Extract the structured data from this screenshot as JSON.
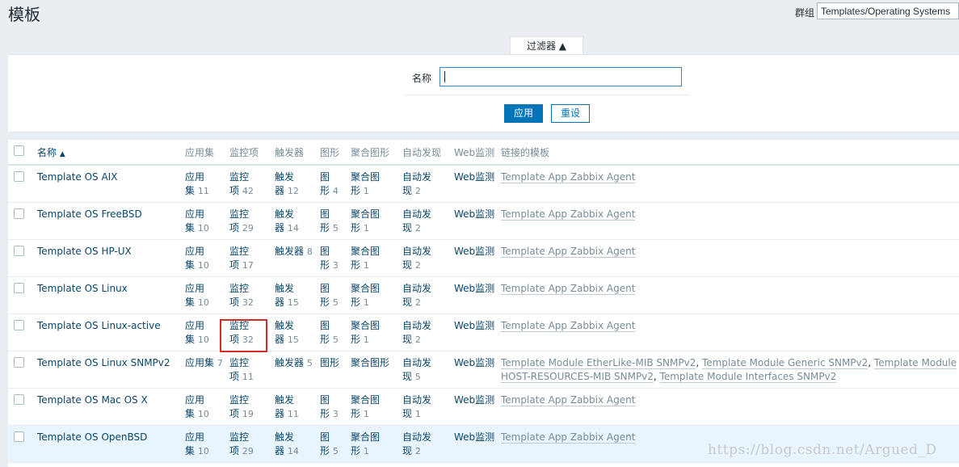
{
  "page": {
    "title": "模板"
  },
  "group": {
    "label": "群组",
    "value": "Templates/Operating Systems"
  },
  "filter": {
    "tab_label": "过滤器 ▲",
    "name_label": "名称",
    "name_value": "",
    "apply_label": "应用",
    "reset_label": "重设"
  },
  "table": {
    "headers": {
      "name": "名称",
      "name_sort": "▲",
      "apps": "应用集",
      "items": "监控项",
      "triggers": "触发器",
      "graphs": "图形",
      "screens": "聚合图形",
      "discovery": "自动发现",
      "web": "Web监测",
      "linked": "链接的模板"
    },
    "rows": [
      {
        "name": "Template OS AIX",
        "apps": [
          "应用",
          "集"
        ],
        "apps_count": "11",
        "items": [
          "监控",
          "项"
        ],
        "items_count": "42",
        "triggers": [
          "触发",
          "器"
        ],
        "triggers_count": "12",
        "graphs": [
          "图",
          "形"
        ],
        "graphs_count": "4",
        "screens": [
          "聚合图",
          "形"
        ],
        "screens_count": "1",
        "discovery": [
          "自动发",
          "现"
        ],
        "discovery_count": "2",
        "web": "Web监测",
        "linked": [
          "Template App Zabbix Agent"
        ]
      },
      {
        "name": "Template OS FreeBSD",
        "apps": [
          "应用",
          "集"
        ],
        "apps_count": "10",
        "items": [
          "监控",
          "项"
        ],
        "items_count": "29",
        "triggers": [
          "触发",
          "器"
        ],
        "triggers_count": "14",
        "graphs": [
          "图",
          "形"
        ],
        "graphs_count": "5",
        "screens": [
          "聚合图",
          "形"
        ],
        "screens_count": "1",
        "discovery": [
          "自动发",
          "现"
        ],
        "discovery_count": "2",
        "web": "Web监测",
        "linked": [
          "Template App Zabbix Agent"
        ]
      },
      {
        "name": "Template OS HP-UX",
        "apps": [
          "应用",
          "集"
        ],
        "apps_count": "10",
        "items": [
          "监控",
          "项"
        ],
        "items_count": "17",
        "triggers": [
          "触发器",
          ""
        ],
        "triggers_count": "8",
        "graphs": [
          "图",
          "形"
        ],
        "graphs_count": "3",
        "screens": [
          "聚合图",
          "形"
        ],
        "screens_count": "1",
        "discovery": [
          "自动发",
          "现"
        ],
        "discovery_count": "2",
        "web": "Web监测",
        "linked": [
          "Template App Zabbix Agent"
        ]
      },
      {
        "name": "Template OS Linux",
        "apps": [
          "应用",
          "集"
        ],
        "apps_count": "10",
        "items": [
          "监控",
          "项"
        ],
        "items_count": "32",
        "triggers": [
          "触发",
          "器"
        ],
        "triggers_count": "15",
        "graphs": [
          "图",
          "形"
        ],
        "graphs_count": "5",
        "screens": [
          "聚合图",
          "形"
        ],
        "screens_count": "1",
        "discovery": [
          "自动发",
          "现"
        ],
        "discovery_count": "2",
        "web": "Web监测",
        "linked": [
          "Template App Zabbix Agent"
        ]
      },
      {
        "name": "Template OS Linux-active",
        "apps": [
          "应用",
          "集"
        ],
        "apps_count": "10",
        "items": [
          "监控",
          "项"
        ],
        "items_count": "32",
        "triggers": [
          "触发",
          "器"
        ],
        "triggers_count": "15",
        "graphs": [
          "图",
          "形"
        ],
        "graphs_count": "5",
        "screens": [
          "聚合图",
          "形"
        ],
        "screens_count": "1",
        "discovery": [
          "自动发",
          "现"
        ],
        "discovery_count": "2",
        "web": "Web监测",
        "linked": [
          "Template App Zabbix Agent"
        ]
      },
      {
        "name": "Template OS Linux SNMPv2",
        "apps": [
          "应用集",
          ""
        ],
        "apps_count": "7",
        "items": [
          "监控",
          "项"
        ],
        "items_count": "11",
        "triggers": [
          "触发器",
          ""
        ],
        "triggers_count": "5",
        "graphs": [
          "图形",
          ""
        ],
        "graphs_count": "",
        "screens": [
          "聚合图形",
          ""
        ],
        "screens_count": "",
        "discovery": [
          "自动发",
          "现"
        ],
        "discovery_count": "5",
        "web": "Web监测",
        "linked": [
          "Template Module EtherLike-MIB SNMPv2",
          "Template Module Generic SNMPv2",
          "Template Module HOST-RESOURCES-MIB SNMPv2",
          "Template Module Interfaces SNMPv2"
        ]
      },
      {
        "name": "Template OS Mac OS X",
        "apps": [
          "应用",
          "集"
        ],
        "apps_count": "10",
        "items": [
          "监控",
          "项"
        ],
        "items_count": "19",
        "triggers": [
          "触发",
          "器"
        ],
        "triggers_count": "11",
        "graphs": [
          "图",
          "形"
        ],
        "graphs_count": "3",
        "screens": [
          "聚合图",
          "形"
        ],
        "screens_count": "1",
        "discovery": [
          "自动发",
          "现"
        ],
        "discovery_count": "1",
        "web": "Web监测",
        "linked": [
          "Template App Zabbix Agent"
        ]
      },
      {
        "name": "Template OS OpenBSD",
        "apps": [
          "应用",
          "集"
        ],
        "apps_count": "10",
        "items": [
          "监控",
          "项"
        ],
        "items_count": "29",
        "triggers": [
          "触发",
          "器"
        ],
        "triggers_count": "14",
        "graphs": [
          "图",
          "形"
        ],
        "graphs_count": "5",
        "screens": [
          "聚合图",
          "形"
        ],
        "screens_count": "1",
        "discovery": [
          "自动发",
          "现"
        ],
        "discovery_count": "2",
        "web": "Web监测",
        "linked": [
          "Template App Zabbix Agent"
        ]
      }
    ]
  },
  "watermark": "https://blog.csdn.net/Argued_D",
  "colors": {
    "accent": "#0275b8",
    "link": "#0a466a",
    "muted": "#768d99",
    "highlight_row": "#e8f5ff",
    "annotation_box": "#d42b2b"
  }
}
